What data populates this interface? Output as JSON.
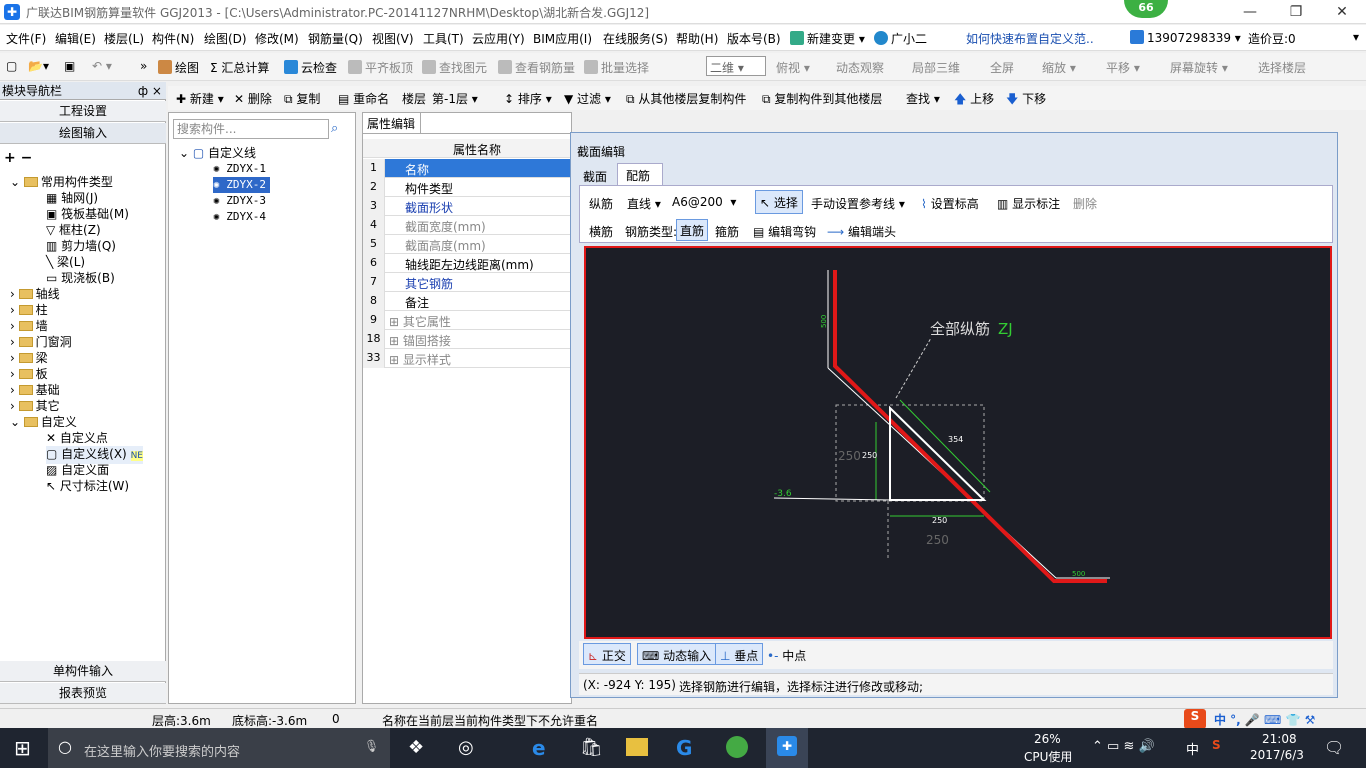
{
  "title": "广联达BIM钢筋算量软件 GGJ2013 - [C:\\Users\\Administrator.PC-20141127NRHM\\Desktop\\湖北新合发.GGJ12]",
  "badge": "66",
  "menu": [
    "文件(F)",
    "编辑(E)",
    "楼层(L)",
    "构件(N)",
    "绘图(D)",
    "修改(M)",
    "钢筋量(Q)",
    "视图(V)",
    "工具(T)",
    "云应用(Y)",
    "BIM应用(I)",
    "在线服务(S)",
    "帮助(H)",
    "版本号(B)",
    "新建变更",
    "广小二",
    "如何快速布置自定义范..",
    "13907298339",
    "造价豆:0"
  ],
  "toolbar1": [
    "绘图",
    "汇总计算",
    "云检查",
    "平齐板顶",
    "查找图元",
    "查看钢筋量",
    "批量选择",
    "二维",
    "俯视",
    "动态观察",
    "局部三维",
    "全屏",
    "缩放",
    "平移",
    "屏幕旋转",
    "选择楼层"
  ],
  "nav": {
    "title": "模块导航栏",
    "pin": "ф ×",
    "btn_top": "工程设置",
    "btn_draw": "绘图输入",
    "btn_single": "单构件输入",
    "btn_report": "报表预览",
    "common": "常用构件类型",
    "common_items": [
      "轴网(J)",
      "筏板基础(M)",
      "框柱(Z)",
      "剪力墙(Q)",
      "梁(L)",
      "现浇板(B)"
    ],
    "groups": [
      "轴线",
      "柱",
      "墙",
      "门窗洞",
      "梁",
      "板",
      "基础",
      "其它"
    ],
    "custom": "自定义",
    "custom_items": [
      "自定义点",
      "自定义线(X)",
      "自定义面",
      "尺寸标注(W)"
    ],
    "ne": "NE"
  },
  "tb2": [
    "新建",
    "删除",
    "复制",
    "重命名",
    "楼层",
    "第-1层",
    "排序",
    "过滤",
    "从其他楼层复制构件",
    "复制构件到其他楼层",
    "查找",
    "上移",
    "下移"
  ],
  "search_placeholder": "搜索构件...",
  "tree_root": "自定义线",
  "tree_items": [
    "ZDYX-1",
    "ZDYX-2",
    "ZDYX-3",
    "ZDYX-4"
  ],
  "props": {
    "tab": "属性编辑",
    "header": "属性名称",
    "rows": [
      {
        "n": "1",
        "name": "名称"
      },
      {
        "n": "2",
        "name": "构件类型"
      },
      {
        "n": "3",
        "name": "截面形状"
      },
      {
        "n": "4",
        "name": "截面宽度(mm)"
      },
      {
        "n": "5",
        "name": "截面高度(mm)"
      },
      {
        "n": "6",
        "name": "轴线距左边线距离(mm)"
      },
      {
        "n": "7",
        "name": "其它钢筋"
      },
      {
        "n": "8",
        "name": "备注"
      },
      {
        "n": "9",
        "name": "其它属性"
      },
      {
        "n": "18",
        "name": "锚固搭接"
      },
      {
        "n": "33",
        "name": "显示样式"
      }
    ]
  },
  "sect": {
    "title": "截面编辑",
    "tab1": "截面",
    "tab2": "配筋",
    "row1": [
      "纵筋",
      "直线",
      "A6@200",
      "选择",
      "手动设置参考线",
      "设置标高",
      "显示标注",
      "删除"
    ],
    "row2": [
      "横筋",
      "钢筋类型:",
      "直筋",
      "箍筋",
      "编辑弯钩",
      "编辑端头"
    ],
    "canvas": {
      "label": "全部纵筋",
      "label2": "ZJ",
      "d250a": "250",
      "d250b": "250",
      "d250c": "250",
      "d250d": "250",
      "d354": "354",
      "d500a": "500",
      "d500b": "500",
      "dm36": "-3.6"
    },
    "bottom": [
      "正交",
      "动态输入",
      "垂点",
      "中点"
    ],
    "coords": "(X: -924 Y: 195)",
    "hint": "选择钢筋进行编辑，选择标注进行修改或移动;"
  },
  "status": {
    "floor_h": "层高:3.6m",
    "base_h": "底标高:-3.6m",
    "zero": "0",
    "msg": "名称在当前层当前构件类型下不允许重名"
  },
  "taskbar": {
    "search": "在这里输入你要搜索的内容",
    "cpu": "26%",
    "cpu_label": "CPU使用",
    "ime": "中",
    "time": "21:08",
    "date": "2017/6/3"
  }
}
